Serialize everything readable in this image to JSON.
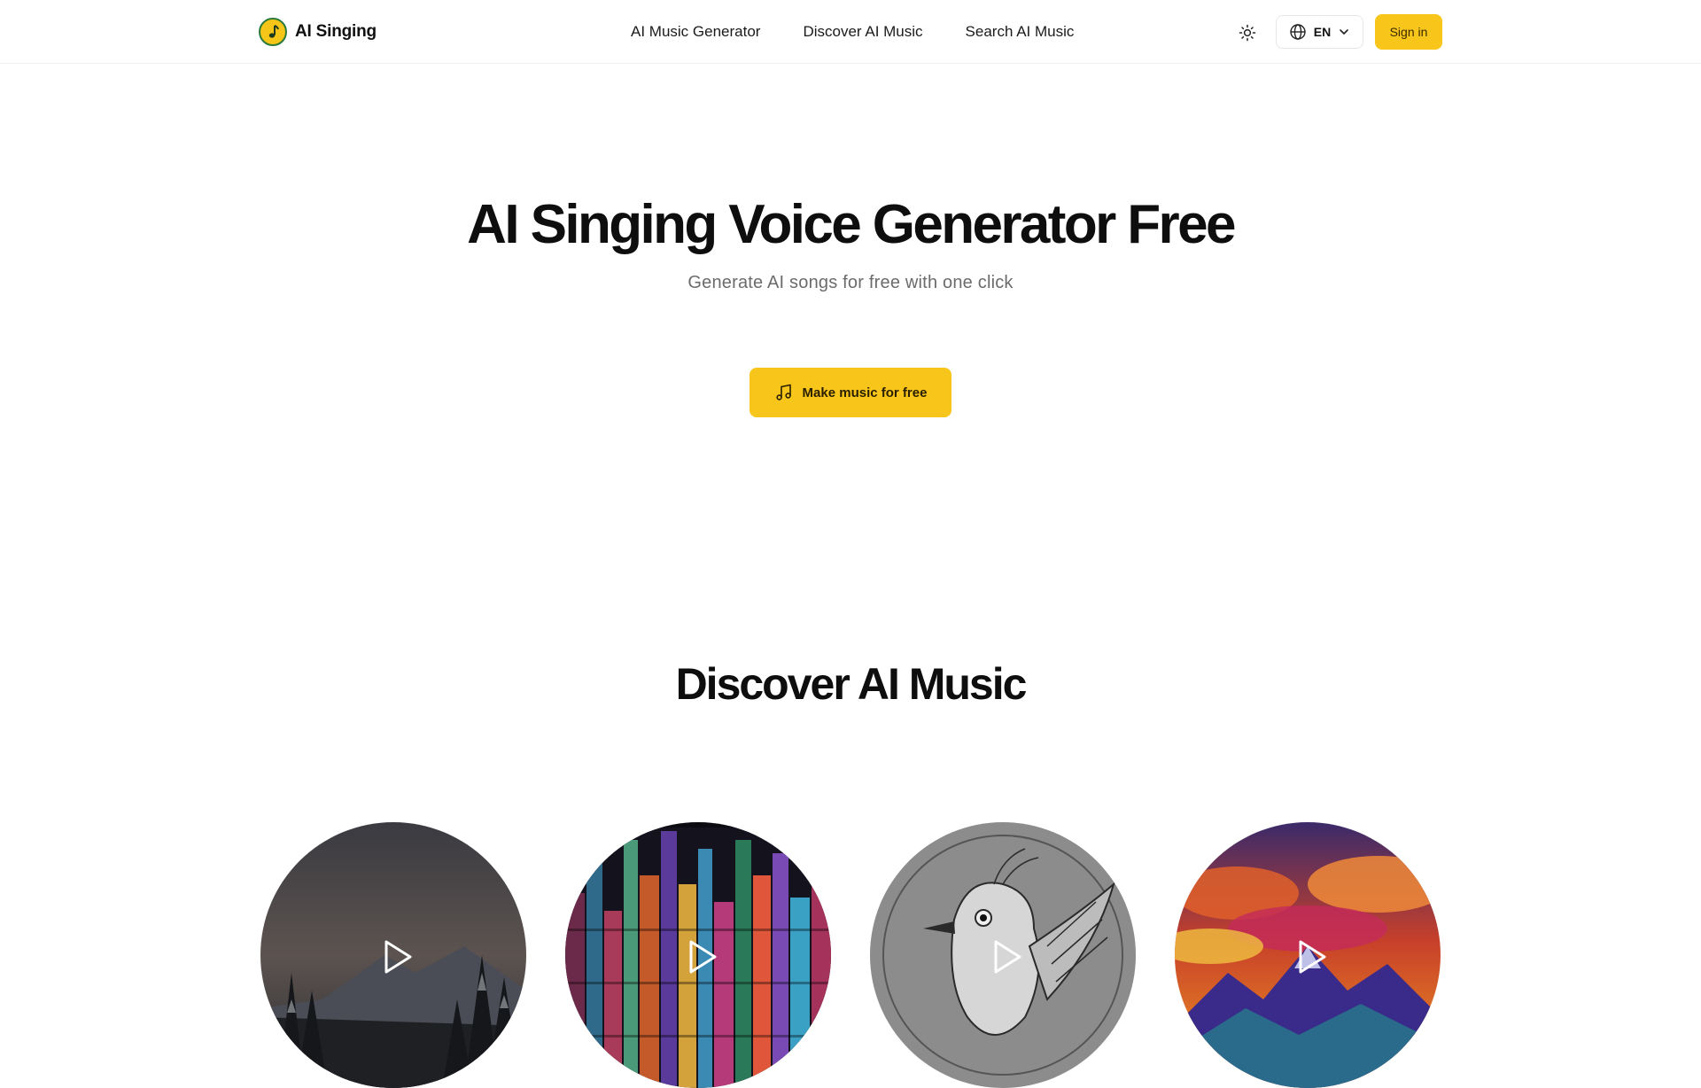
{
  "brand": {
    "name": "AI Singing",
    "icon": "music-note-icon"
  },
  "nav": [
    {
      "label": "AI Music Generator"
    },
    {
      "label": "Discover AI Music"
    },
    {
      "label": "Search AI Music"
    }
  ],
  "header_actions": {
    "theme_icon": "sun-icon",
    "language": {
      "label": "EN",
      "icon": "globe-icon",
      "caret": "chevron-down-icon"
    },
    "signin_label": "Sign in"
  },
  "hero": {
    "title": "AI Singing Voice Generator Free",
    "subtitle": "Generate AI songs for free with one click",
    "cta_label": "Make music for free",
    "cta_icon": "music-notes-icon"
  },
  "discover": {
    "title": "Discover AI Music",
    "cards": [
      {
        "art": "snowy-forest-night",
        "icon": "play-icon"
      },
      {
        "art": "neon-city",
        "icon": "play-icon"
      },
      {
        "art": "sketched-bird",
        "icon": "play-icon"
      },
      {
        "art": "colorful-mountains",
        "icon": "play-icon"
      }
    ]
  },
  "colors": {
    "accent": "#f8c61b",
    "text": "#111111",
    "muted": "#6b6b6b",
    "border": "#e6e6e6"
  }
}
